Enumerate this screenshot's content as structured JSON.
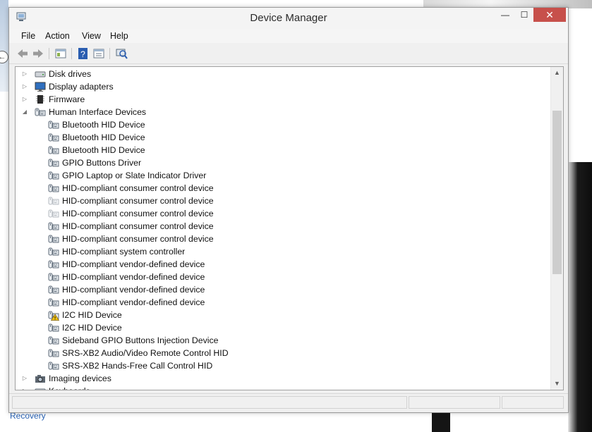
{
  "window": {
    "title": "Device Manager"
  },
  "menu": [
    "File",
    "Action",
    "View",
    "Help"
  ],
  "desktop": {
    "recovery_label": "Recovery"
  },
  "tree": [
    {
      "label": "Disk drives",
      "level": 0,
      "expander": "collapsed",
      "icon": "disk-icon"
    },
    {
      "label": "Display adapters",
      "level": 0,
      "expander": "collapsed",
      "icon": "monitor-icon"
    },
    {
      "label": "Firmware",
      "level": 0,
      "expander": "collapsed",
      "icon": "chip-icon"
    },
    {
      "label": "Human Interface Devices",
      "level": 0,
      "expander": "expanded",
      "icon": "hid-icon"
    },
    {
      "label": "Bluetooth HID Device",
      "level": 1,
      "icon": "hid-icon"
    },
    {
      "label": "Bluetooth HID Device",
      "level": 1,
      "icon": "hid-icon"
    },
    {
      "label": "Bluetooth HID Device",
      "level": 1,
      "icon": "hid-icon"
    },
    {
      "label": "GPIO Buttons Driver",
      "level": 1,
      "icon": "hid-icon"
    },
    {
      "label": "GPIO Laptop or Slate Indicator Driver",
      "level": 1,
      "icon": "hid-icon"
    },
    {
      "label": "HID-compliant consumer control device",
      "level": 1,
      "icon": "hid-icon"
    },
    {
      "label": "HID-compliant consumer control device",
      "level": 1,
      "icon": "hid-faded-icon"
    },
    {
      "label": "HID-compliant consumer control device",
      "level": 1,
      "icon": "hid-faded-icon"
    },
    {
      "label": "HID-compliant consumer control device",
      "level": 1,
      "icon": "hid-icon"
    },
    {
      "label": "HID-compliant consumer control device",
      "level": 1,
      "icon": "hid-icon"
    },
    {
      "label": "HID-compliant system controller",
      "level": 1,
      "icon": "hid-icon"
    },
    {
      "label": "HID-compliant vendor-defined device",
      "level": 1,
      "icon": "hid-icon"
    },
    {
      "label": "HID-compliant vendor-defined device",
      "level": 1,
      "icon": "hid-icon"
    },
    {
      "label": "HID-compliant vendor-defined device",
      "level": 1,
      "icon": "hid-icon"
    },
    {
      "label": "HID-compliant vendor-defined device",
      "level": 1,
      "icon": "hid-icon"
    },
    {
      "label": "I2C HID Device",
      "level": 1,
      "icon": "hid-warning-icon"
    },
    {
      "label": "I2C HID Device",
      "level": 1,
      "icon": "hid-icon"
    },
    {
      "label": "Sideband GPIO Buttons Injection Device",
      "level": 1,
      "icon": "hid-icon"
    },
    {
      "label": "SRS-XB2 Audio/Video Remote Control HID",
      "level": 1,
      "icon": "hid-icon"
    },
    {
      "label": "SRS-XB2 Hands-Free Call Control HID",
      "level": 1,
      "icon": "hid-icon"
    },
    {
      "label": "Imaging devices",
      "level": 0,
      "expander": "collapsed",
      "icon": "camera-icon"
    },
    {
      "label": "Keyboards",
      "level": 0,
      "expander": "collapsed",
      "icon": "keyboard-icon"
    }
  ]
}
